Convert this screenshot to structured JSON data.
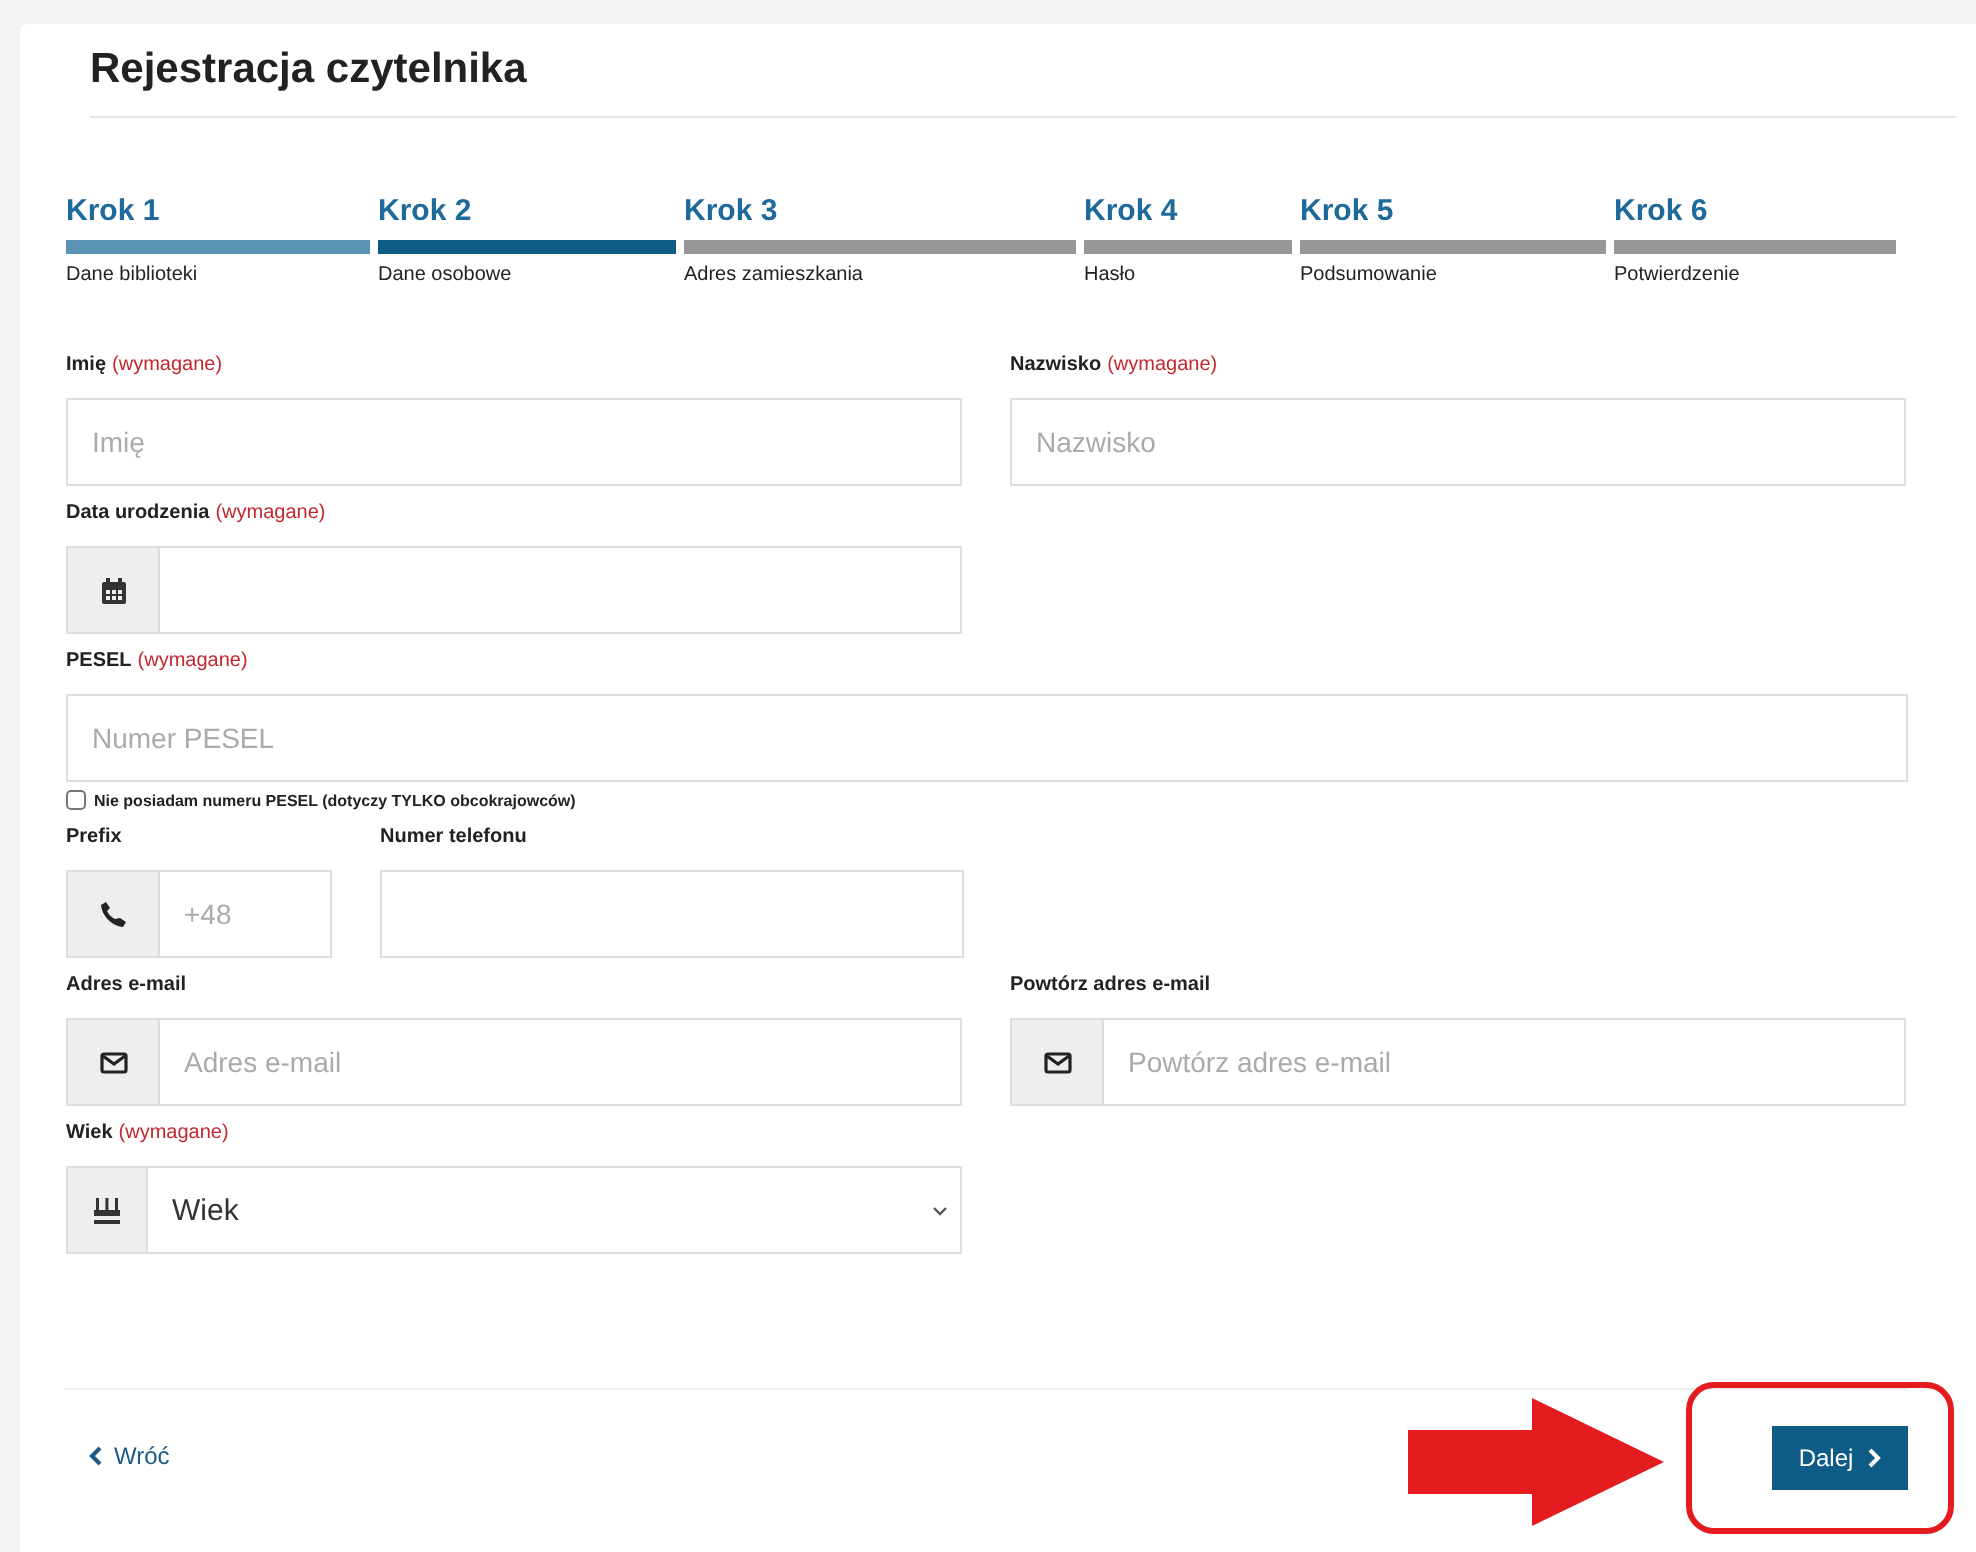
{
  "title": "Rejestracja czytelnika",
  "steps": [
    {
      "title": "Krok 1",
      "label": "Dane biblioteki",
      "completed": true,
      "selected": false
    },
    {
      "title": "Krok 2",
      "label": "Dane osobowe",
      "completed": false,
      "selected": true
    },
    {
      "title": "Krok 3",
      "label": "Adres zamieszkania",
      "completed": false,
      "selected": false
    },
    {
      "title": "Krok 4",
      "label": "Hasło",
      "completed": false,
      "selected": false
    },
    {
      "title": "Krok 5",
      "label": "Podsumowanie",
      "completed": false,
      "selected": false
    },
    {
      "title": "Krok 6",
      "label": "Potwierdzenie",
      "completed": false,
      "selected": false
    }
  ],
  "first_name": {
    "label": "Imię",
    "required": "(wymagane)",
    "placeholder": "Imię"
  },
  "last_name": {
    "label": "Nazwisko",
    "required": "(wymagane)",
    "placeholder": "Nazwisko"
  },
  "birth_date": {
    "label": "Data urodzenia",
    "required": "(wymagane)"
  },
  "pesel": {
    "label": "PESEL",
    "required": "(wymagane)",
    "placeholder": "Numer PESEL"
  },
  "no_pesel": {
    "label": "Nie posiadam numeru PESEL (dotyczy TYLKO obcokrajowców)",
    "checked": false
  },
  "prefix": {
    "label": "Prefix",
    "placeholder": "+48"
  },
  "phone": {
    "label": "Numer telefonu"
  },
  "email": {
    "label": "Adres e-mail",
    "placeholder": "Adres e-mail"
  },
  "email_repeat": {
    "label": "Powtórz adres e-mail",
    "placeholder": "Powtórz adres e-mail"
  },
  "age": {
    "label": "Wiek",
    "required": "(wymagane)",
    "value": "Wiek"
  },
  "back": "Wróć",
  "next": "Dalej"
}
